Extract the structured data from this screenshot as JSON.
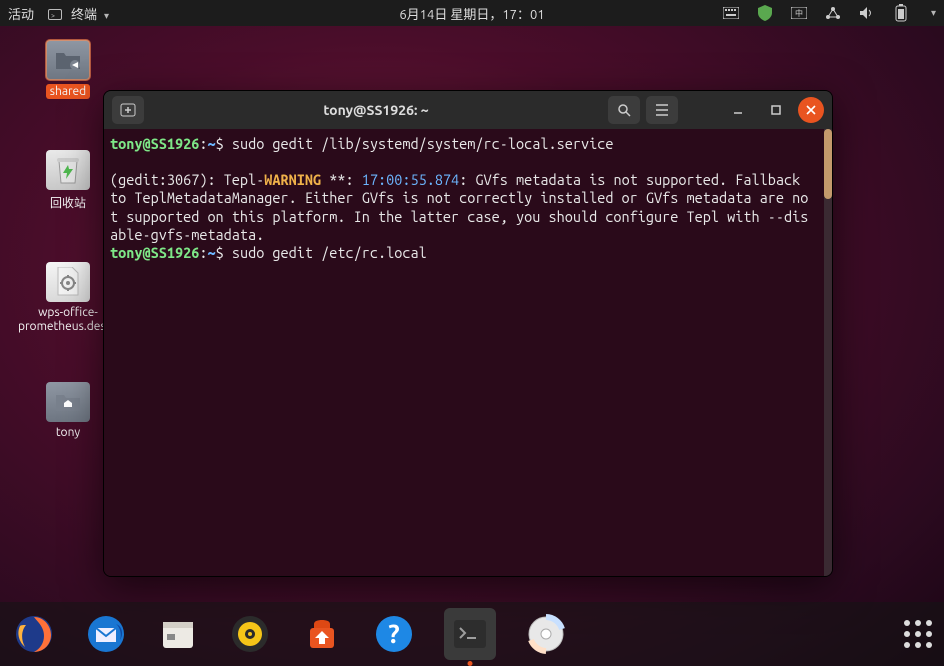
{
  "topbar": {
    "activities": "活动",
    "app_menu": "终端",
    "clock": "6月14日 星期日，17：01"
  },
  "desktop": {
    "shared": "shared",
    "trash": "回收站",
    "wps": "wps-office-prometheus.desktop",
    "home": "tony"
  },
  "terminal": {
    "title": "tony@SS1926: ~",
    "prompt_user": "tony@SS1926",
    "prompt_path": "~",
    "cmd1": "sudo gedit /lib/systemd/system/rc-local.service",
    "msg_prefix": "(gedit:3067): Tepl-",
    "msg_warning": "WARNING",
    "msg_stars": " **: ",
    "msg_ts": "17:00:55.874",
    "msg_body": ": GVfs metadata is not supported. Fallback to TeplMetadataManager. Either GVfs is not correctly installed or GVfs metadata are not supported on this platform. In the latter case, you should configure Tepl with --disable-gvfs-metadata.",
    "cmd2": "sudo gedit /etc/rc.local"
  },
  "dock": {
    "firefox": "Firefox",
    "thunderbird": "Thunderbird",
    "files": "文件",
    "rhythmbox": "Rhythmbox",
    "software": "Ubuntu Software",
    "help": "帮助",
    "terminal": "终端",
    "disc": "光盘",
    "apps": "显示应用程序"
  }
}
